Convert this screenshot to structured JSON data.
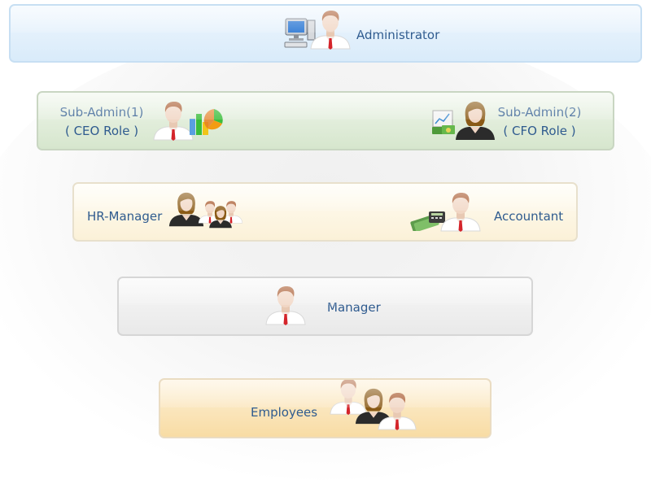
{
  "levels": {
    "administrator": {
      "label": "Administrator"
    },
    "sub_admin_1": {
      "line1": "Sub-Admin(1)",
      "line2": "( CEO Role )"
    },
    "sub_admin_2": {
      "line1": "Sub-Admin(2)",
      "line2": "( CFO Role )"
    },
    "hr_manager": {
      "label": "HR-Manager"
    },
    "accountant": {
      "label": "Accountant"
    },
    "manager": {
      "label": "Manager"
    },
    "employees": {
      "label": "Employees"
    }
  },
  "icons": {
    "administrator": [
      "computer-icon",
      "male-user-icon"
    ],
    "sub_admin_1": [
      "male-user-icon",
      "chart-icon"
    ],
    "sub_admin_2": [
      "finance-chart-icon",
      "female-user-icon"
    ],
    "hr_manager": [
      "female-user-icon",
      "group-icon"
    ],
    "accountant": [
      "cash-calculator-icon",
      "male-user-icon"
    ],
    "manager": [
      "male-user-icon"
    ],
    "employees": [
      "male-user-icon",
      "female-user-icon",
      "male-user-icon"
    ]
  },
  "colors": {
    "label_text": "#2f5b8f",
    "administrator_bar": "#e3f0fb",
    "sub_admin_bar": "#dfeadb",
    "hr_bar": "#fcf4e0",
    "manager_bar": "#efefef",
    "employees_bar": "#fae4b6"
  }
}
